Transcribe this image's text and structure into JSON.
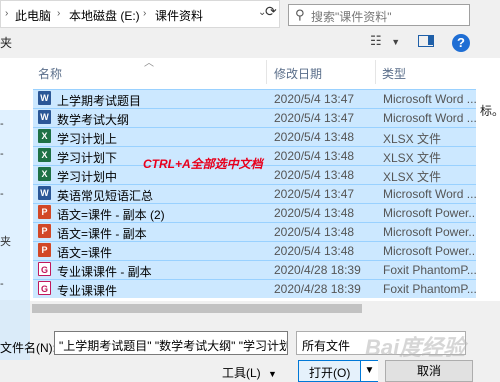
{
  "breadcrumb": {
    "items": [
      "此电脑",
      "本地磁盘 (E:)",
      "课件资料"
    ]
  },
  "search": {
    "placeholder": "搜索\"课件资料\""
  },
  "toolbar": {
    "left_label": "夹"
  },
  "nav_glyphs": [
    "-",
    "-",
    "-",
    "夹",
    "-"
  ],
  "columns": {
    "name": "名称",
    "date": "修改日期",
    "type": "类型"
  },
  "files": [
    {
      "name": "上学期考试题目",
      "date": "2020/5/4 13:47",
      "type": "Microsoft Word ...",
      "icon": "word-icon"
    },
    {
      "name": "数学考试大纲",
      "date": "2020/5/4 13:47",
      "type": "Microsoft Word ...",
      "icon": "word-icon"
    },
    {
      "name": "学习计划上",
      "date": "2020/5/4 13:48",
      "type": "XLSX 文件",
      "icon": "excel-icon"
    },
    {
      "name": "学习计划下",
      "date": "2020/5/4 13:48",
      "type": "XLSX 文件",
      "icon": "excel-icon"
    },
    {
      "name": "学习计划中",
      "date": "2020/5/4 13:48",
      "type": "XLSX 文件",
      "icon": "excel-icon"
    },
    {
      "name": "英语常见短语汇总",
      "date": "2020/5/4 13:47",
      "type": "Microsoft Word ...",
      "icon": "word-icon"
    },
    {
      "name": "语文=课件 - 副本 (2)",
      "date": "2020/5/4 13:48",
      "type": "Microsoft Power...",
      "icon": "powerpoint-icon"
    },
    {
      "name": "语文=课件 - 副本",
      "date": "2020/5/4 13:48",
      "type": "Microsoft Power...",
      "icon": "powerpoint-icon"
    },
    {
      "name": "语文=课件",
      "date": "2020/5/4 13:48",
      "type": "Microsoft Power...",
      "icon": "powerpoint-icon"
    },
    {
      "name": "专业课课件 - 副本",
      "date": "2020/4/28 18:39",
      "type": "Foxit PhantomP...",
      "icon": "foxit-pdf-icon"
    },
    {
      "name": "专业课课件",
      "date": "2020/4/28 18:39",
      "type": "Foxit PhantomP...",
      "icon": "foxit-pdf-icon"
    }
  ],
  "annotation": "CTRL+A全部选中文档",
  "right_strip_text": "标。",
  "filename": {
    "label": "文件名(N):",
    "value": "\"上学期考试题目\" \"数学考试大纲\" \"学习计划"
  },
  "filter": {
    "value": "所有文件"
  },
  "buttons": {
    "tools": "工具(L)",
    "open": "打开(O)",
    "cancel": "取消"
  },
  "watermark": "Bai度经验",
  "colors": {
    "selection": "#cce8ff",
    "accent": "#0078d7",
    "annotation": "#e8001c"
  }
}
